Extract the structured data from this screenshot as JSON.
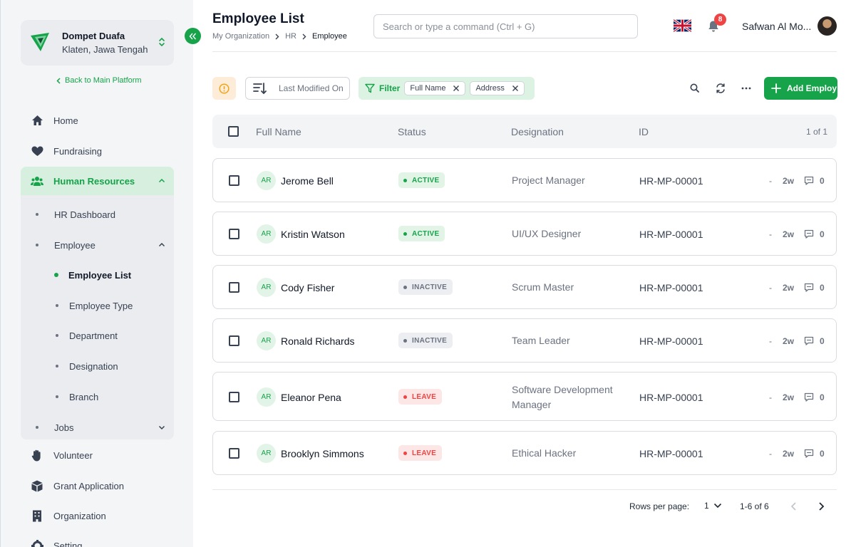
{
  "organization": {
    "name": "Dompet Duafa",
    "location": "Klaten, Jawa Tengah"
  },
  "sidebar": {
    "back_link": "Back to Main Platform",
    "items_top": [
      {
        "label": "Home",
        "icon": "home-icon"
      },
      {
        "label": "Fundraising",
        "icon": "heart-icon"
      }
    ],
    "group": {
      "label": "Human Resources",
      "icon": "people-icon",
      "children": [
        {
          "label": "HR Dashboard"
        },
        {
          "label": "Employee"
        }
      ],
      "employee_children": [
        {
          "label": "Employee List"
        },
        {
          "label": "Employee Type"
        },
        {
          "label": "Department"
        },
        {
          "label": "Designation"
        },
        {
          "label": "Branch"
        }
      ],
      "jobs": {
        "label": "Jobs"
      }
    },
    "items_bottom": [
      {
        "label": "Volunteer",
        "icon": "hand-icon"
      },
      {
        "label": "Grant Application",
        "icon": "box-icon"
      },
      {
        "label": "Organization",
        "icon": "building-icon"
      },
      {
        "label": "Setting",
        "icon": "gear-icon"
      }
    ]
  },
  "header": {
    "title": "Employee List",
    "breadcrumb": [
      "My Organization",
      "HR",
      "Employee"
    ],
    "search_placeholder": "Search or type a command (Ctrl + G)",
    "notification_count": "8",
    "user_name": "Safwan Al Mo..."
  },
  "toolbar": {
    "sort_label": "Last Modified On",
    "filter_label": "Filter",
    "filter_chips": [
      "Full Name",
      "Address"
    ],
    "add_label": "Add Employ"
  },
  "table": {
    "columns": [
      "Full Name",
      "Status",
      "Designation",
      "ID"
    ],
    "page_indicator": "1 of 1",
    "rows": [
      {
        "initials": "AR",
        "name": "Jerome Bell",
        "status": "ACTIVE",
        "designation": "Project Manager",
        "id": "HR-MP-00001",
        "dash": "-",
        "age": "2w",
        "comments": "0"
      },
      {
        "initials": "AR",
        "name": "Kristin Watson",
        "status": "ACTIVE",
        "designation": "UI/UX Designer",
        "id": "HR-MP-00001",
        "dash": "-",
        "age": "2w",
        "comments": "0"
      },
      {
        "initials": "AR",
        "name": "Cody Fisher",
        "status": "INACTIVE",
        "designation": "Scrum Master",
        "id": "HR-MP-00001",
        "dash": "-",
        "age": "2w",
        "comments": "0"
      },
      {
        "initials": "AR",
        "name": "Ronald Richards",
        "status": "INACTIVE",
        "designation": "Team Leader",
        "id": "HR-MP-00001",
        "dash": "-",
        "age": "2w",
        "comments": "0"
      },
      {
        "initials": "AR",
        "name": "Eleanor Pena",
        "status": "LEAVE",
        "designation": "Software Development Manager",
        "id": "HR-MP-00001",
        "dash": "-",
        "age": "2w",
        "comments": "0"
      },
      {
        "initials": "AR",
        "name": "Brooklyn Simmons",
        "status": "LEAVE",
        "designation": "Ethical Hacker",
        "id": "HR-MP-00001",
        "dash": "-",
        "age": "2w",
        "comments": "0"
      }
    ]
  },
  "pagination": {
    "rows_per_page_label": "Rows per page:",
    "rows_per_page_value": "1",
    "range": "1-6 of 6"
  },
  "colors": {
    "accent": "#16a34a",
    "warning": "#f59e0b",
    "danger": "#ef4444"
  }
}
